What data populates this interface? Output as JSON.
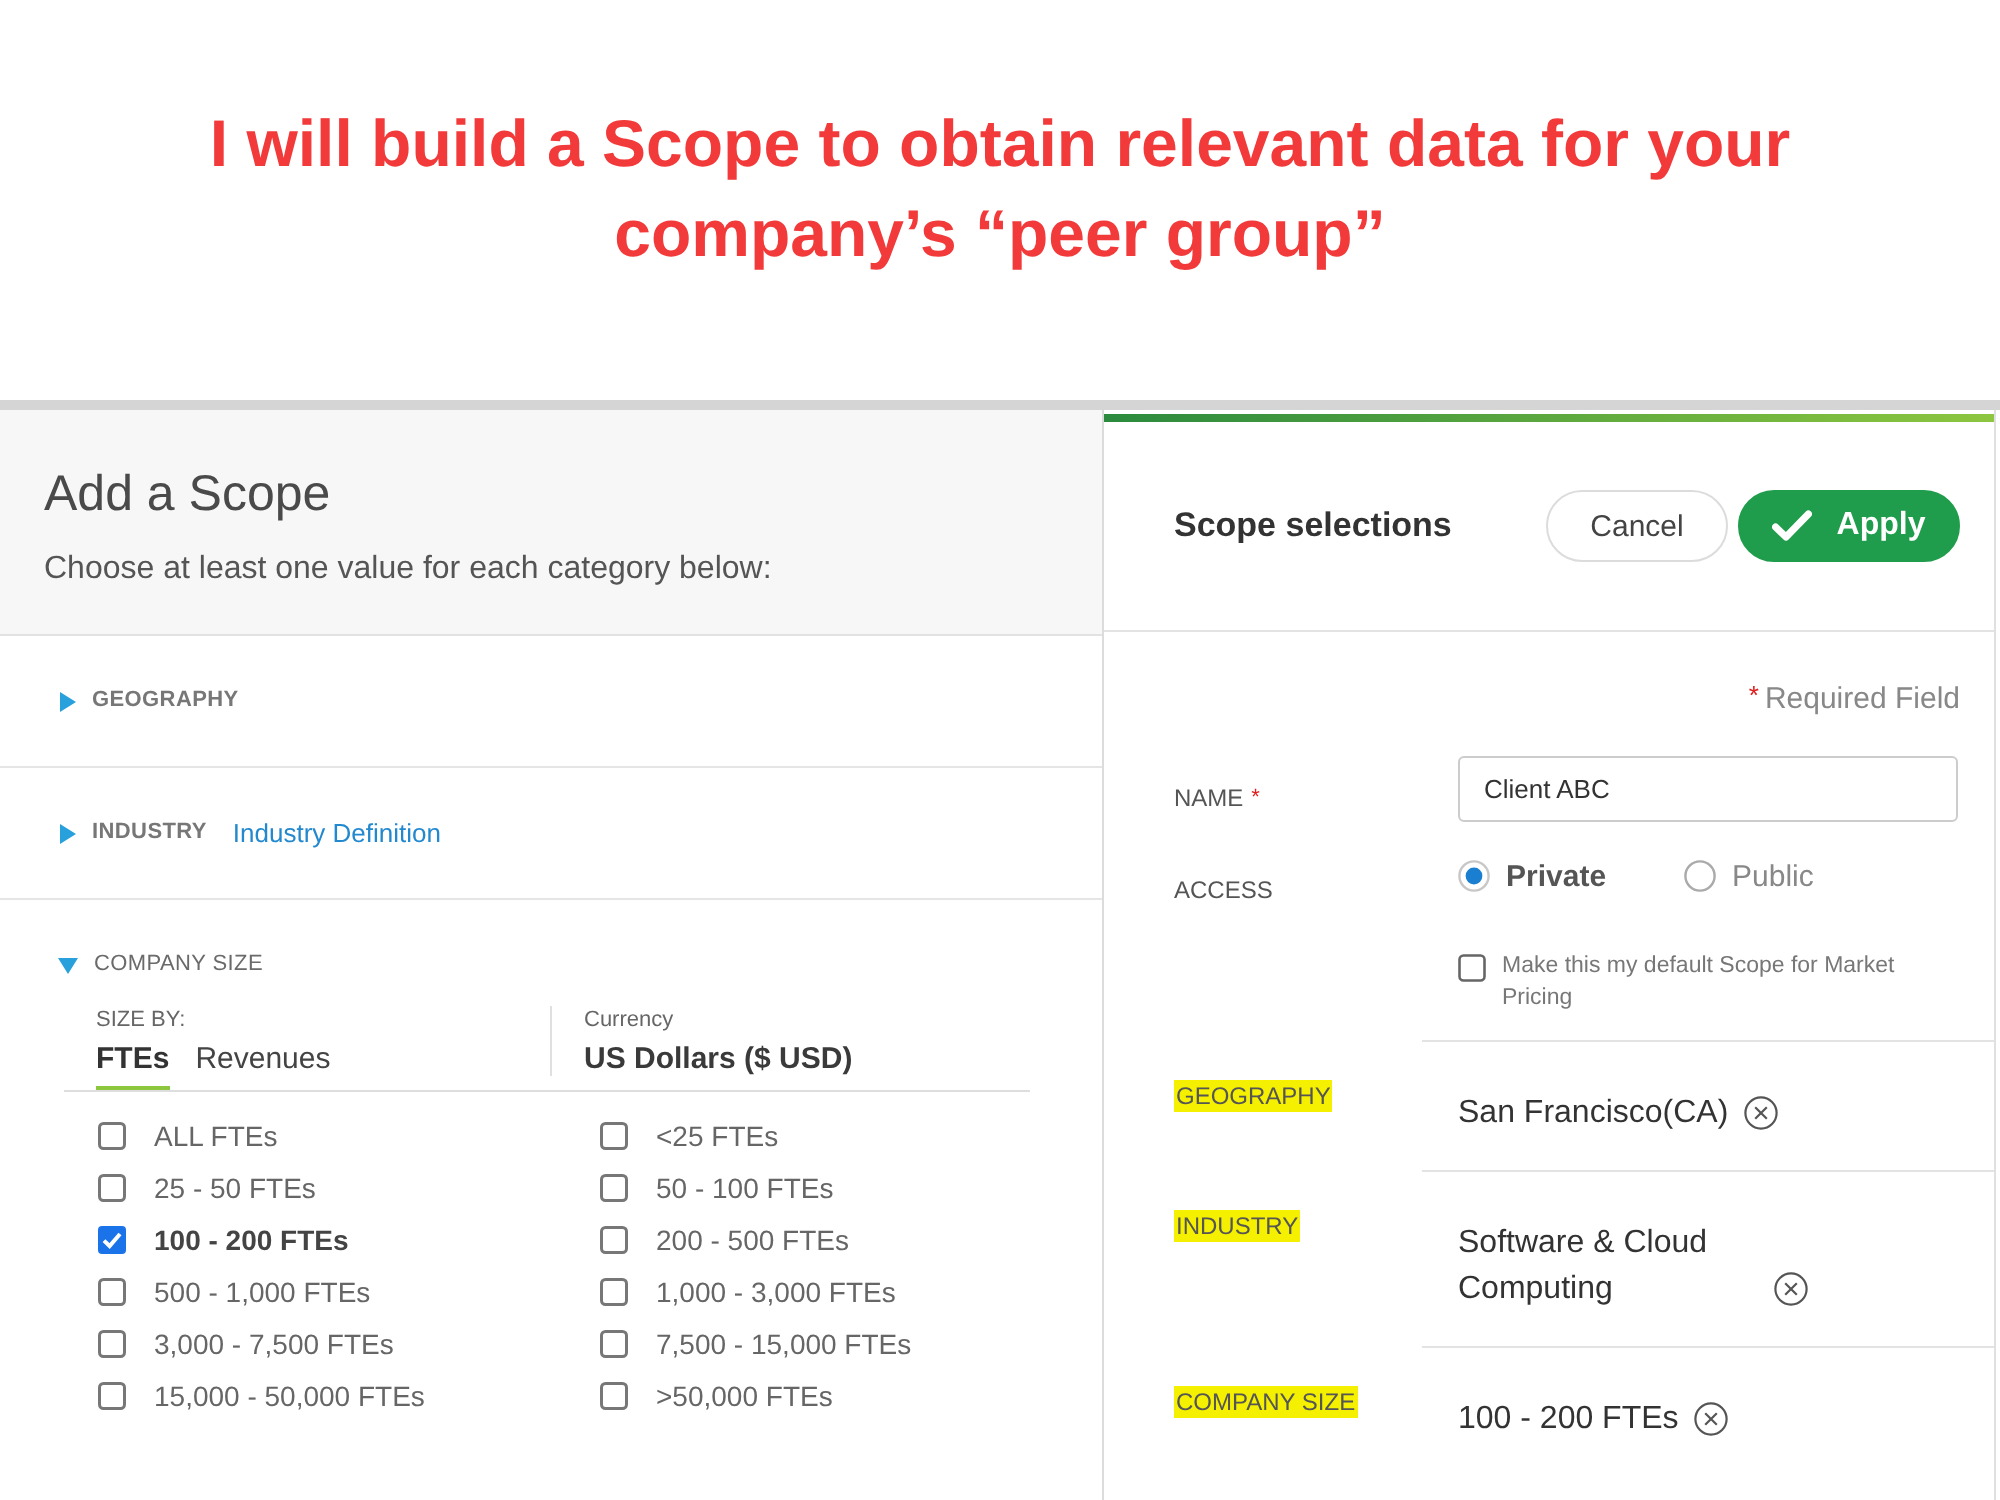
{
  "headline": "I will build a Scope to obtain relevant data for your company’s “peer group”",
  "left_panel": {
    "title": "Add a Scope",
    "subtitle": "Choose at least one value for each category below:",
    "sections": [
      {
        "label": "GEOGRAPHY",
        "expanded": false
      },
      {
        "label": "INDUSTRY",
        "expanded": false,
        "link": "Industry Definition"
      },
      {
        "label": "COMPANY SIZE",
        "expanded": true,
        "size_by": {
          "label": "SIZE BY:",
          "options": [
            {
              "label": "FTEs",
              "selected": true
            },
            {
              "label": "Revenues",
              "selected": false
            }
          ]
        },
        "currency": {
          "label": "Currency",
          "value": "US Dollars ($ USD)"
        },
        "option_columns": [
          {
            "options": [
              {
                "label": "ALL FTEs",
                "checked": false
              },
              {
                "label": "25 - 50 FTEs",
                "checked": false
              },
              {
                "label": "100 - 200 FTEs",
                "checked": true
              },
              {
                "label": "500 - 1,000 FTEs",
                "checked": false
              },
              {
                "label": "3,000 - 7,500 FTEs",
                "checked": false
              },
              {
                "label": "15,000 - 50,000 FTEs",
                "checked": false
              }
            ]
          },
          {
            "options": [
              {
                "label": "<25 FTEs",
                "checked": false
              },
              {
                "label": "50 - 100 FTEs",
                "checked": false
              },
              {
                "label": "200 - 500 FTEs",
                "checked": false
              },
              {
                "label": "1,000 - 3,000 FTEs",
                "checked": false
              },
              {
                "label": "7,500 - 15,000 FTEs",
                "checked": false
              },
              {
                "label": ">50,000 FTEs",
                "checked": false
              }
            ]
          }
        ]
      }
    ]
  },
  "right_panel": {
    "title": "Scope selections",
    "buttons": [
      {
        "label": "Cancel",
        "kind": "secondary"
      },
      {
        "label": "Apply",
        "kind": "primary"
      }
    ],
    "required_note": {
      "mark": "*",
      "text": "Required Field"
    },
    "name_field": {
      "label": "NAME",
      "required_mark": "*",
      "value": "Client ABC"
    },
    "access": {
      "label": "ACCESS",
      "options": [
        {
          "label": "Private",
          "selected": true
        },
        {
          "label": "Public",
          "selected": false
        }
      ]
    },
    "default_option": {
      "label": "Make this my default Scope for Market Pricing",
      "checked": false
    },
    "selections": [
      {
        "label": "GEOGRAPHY",
        "value": "San Francisco(CA)",
        "highlighted": true
      },
      {
        "label": "INDUSTRY",
        "value": "Software & Cloud Computing",
        "highlighted": true
      },
      {
        "label": "COMPANY SIZE",
        "value": "100 - 200 FTEs",
        "highlighted": true
      }
    ]
  }
}
